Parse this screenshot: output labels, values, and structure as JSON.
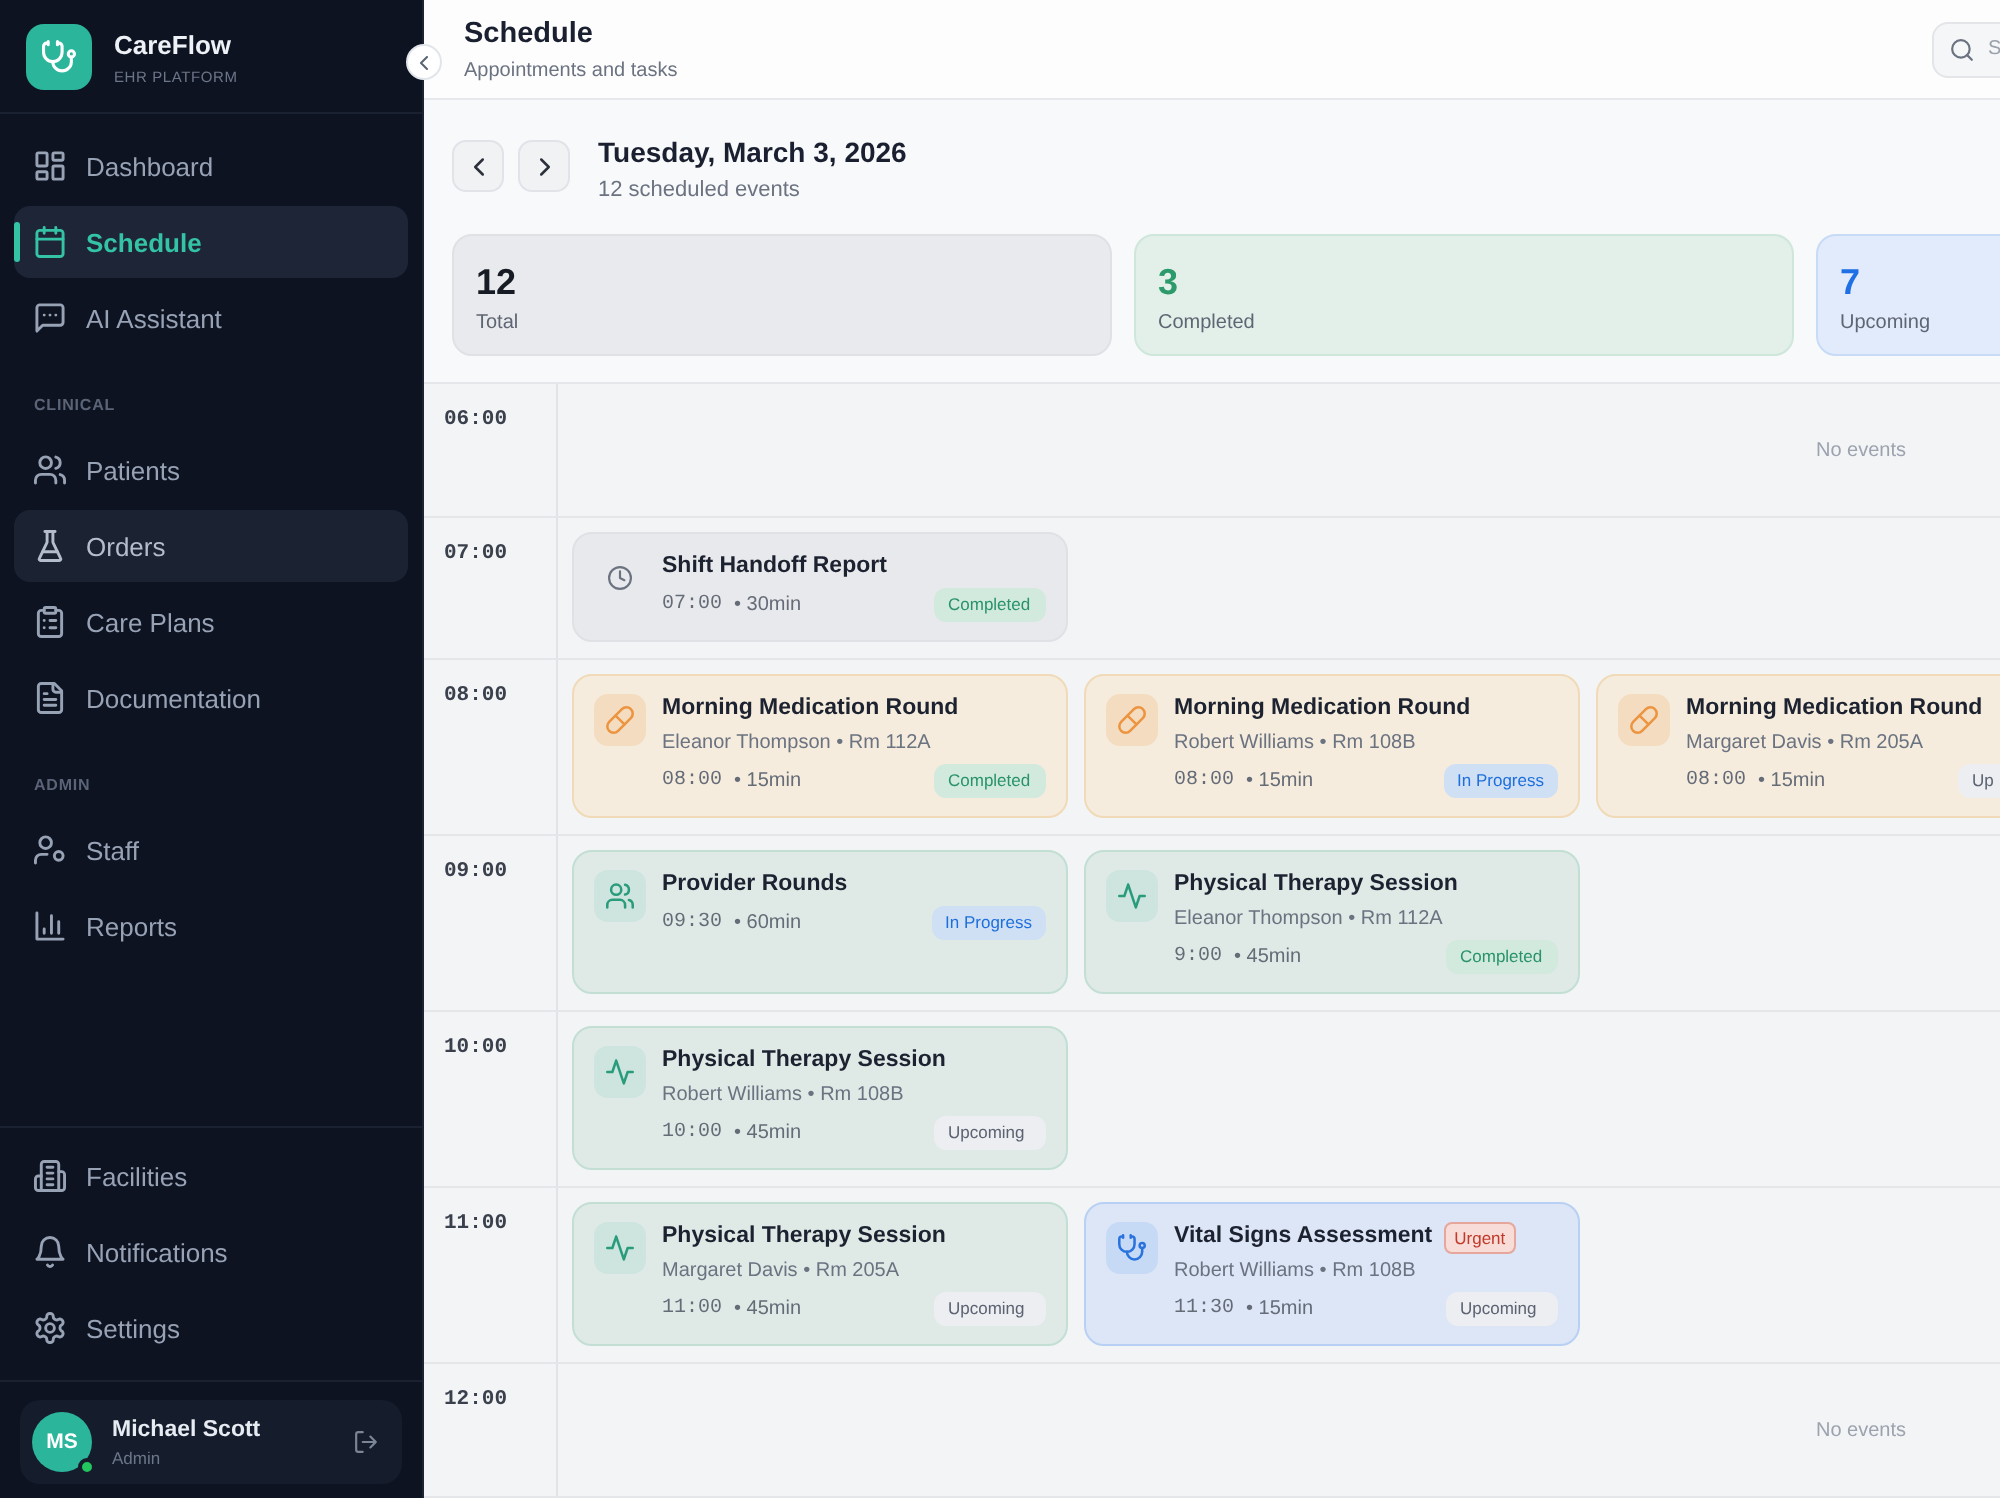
{
  "sidebar": {
    "brand": {
      "name": "CareFlow",
      "subtitle": "EHR PLATFORM"
    },
    "sections": [
      {
        "items": [
          {
            "label": "Dashboard",
            "selected": false,
            "hovered": false
          },
          {
            "label": "Schedule",
            "selected": true,
            "hovered": false
          },
          {
            "label": "AI Assistant",
            "selected": false,
            "hovered": false
          }
        ]
      },
      {
        "label": "CLINICAL",
        "items": [
          {
            "label": "Patients",
            "selected": false,
            "hovered": false
          },
          {
            "label": "Orders",
            "selected": false,
            "hovered": true
          },
          {
            "label": "Care Plans",
            "selected": false,
            "hovered": false
          },
          {
            "label": "Documentation",
            "selected": false,
            "hovered": false
          }
        ]
      },
      {
        "label": "ADMIN",
        "items": [
          {
            "label": "Staff",
            "selected": false,
            "hovered": false
          },
          {
            "label": "Reports",
            "selected": false,
            "hovered": false
          }
        ]
      }
    ],
    "footer_items": [
      {
        "label": "Facilities",
        "selected": false,
        "hovered": false
      },
      {
        "label": "Notifications",
        "selected": false,
        "hovered": false
      },
      {
        "label": "Settings",
        "selected": false,
        "hovered": false
      }
    ],
    "user": {
      "initials": "MS",
      "name": "Michael Scott",
      "role": "Admin",
      "online": true
    }
  },
  "header": {
    "title": "Schedule",
    "subtitle": "Appointments and tasks",
    "search": {
      "placeholder": "S"
    }
  },
  "day": {
    "date": "Tuesday, March 3, 2026",
    "summary": "12 scheduled events"
  },
  "stats": [
    {
      "kind": "total",
      "value": "12",
      "label": "Total"
    },
    {
      "kind": "completed",
      "value": "3",
      "label": "Completed"
    },
    {
      "kind": "upcoming",
      "value": "7",
      "label": "Upcoming"
    }
  ],
  "schedule": [
    {
      "time": "06:00",
      "empty_text": "No events"
    },
    {
      "time": "07:00",
      "events": [
        {
          "kind": "admin",
          "title": "Shift Handoff Report",
          "time": "07:00",
          "duration": "• 30min",
          "status": {
            "label": "Completed",
            "kind": "completed"
          }
        }
      ]
    },
    {
      "time": "08:00",
      "events": [
        {
          "kind": "medication",
          "title": "Morning Medication Round",
          "detail": "Eleanor Thompson • Rm 112A",
          "time": "08:00",
          "duration": "• 15min",
          "status": {
            "label": "Completed",
            "kind": "completed"
          }
        },
        {
          "kind": "medication",
          "title": "Morning Medication Round",
          "detail": "Robert Williams • Rm 108B",
          "time": "08:00",
          "duration": "• 15min",
          "status": {
            "label": "In Progress",
            "kind": "in_progress"
          }
        },
        {
          "kind": "medication",
          "title": "Morning Medication Round",
          "detail": "Margaret Davis • Rm 205A",
          "time": "08:00",
          "duration": "• 15min",
          "status": {
            "label": "Up",
            "kind": "upcoming"
          }
        }
      ]
    },
    {
      "time": "09:00",
      "events": [
        {
          "kind": "rounds",
          "title": "Provider Rounds",
          "time": "09:30",
          "duration": "• 60min",
          "status": {
            "label": "In Progress",
            "kind": "in_progress"
          }
        },
        {
          "kind": "therapy",
          "title": "Physical Therapy Session",
          "detail": "Eleanor Thompson • Rm 112A",
          "time": "9:00",
          "duration": "• 45min",
          "status": {
            "label": "Completed",
            "kind": "completed"
          }
        }
      ]
    },
    {
      "time": "10:00",
      "events": [
        {
          "kind": "therapy",
          "title": "Physical Therapy Session",
          "detail": "Robert Williams • Rm 108B",
          "time": "10:00",
          "duration": "• 45min",
          "status": {
            "label": "Upcoming",
            "kind": "upcoming"
          }
        }
      ]
    },
    {
      "time": "11:00",
      "events": [
        {
          "kind": "therapy",
          "title": "Physical Therapy Session",
          "detail": "Margaret Davis • Rm 205A",
          "time": "11:00",
          "duration": "• 45min",
          "status": {
            "label": "Upcoming",
            "kind": "upcoming"
          }
        },
        {
          "kind": "vitals",
          "title": "Vital Signs Assessment",
          "tag": "Urgent",
          "detail": "Robert Williams • Rm 108B",
          "time": "11:30",
          "duration": "• 15min",
          "status": {
            "label": "Upcoming",
            "kind": "upcoming"
          }
        }
      ]
    },
    {
      "time": "12:00",
      "empty_text": "No events"
    }
  ]
}
